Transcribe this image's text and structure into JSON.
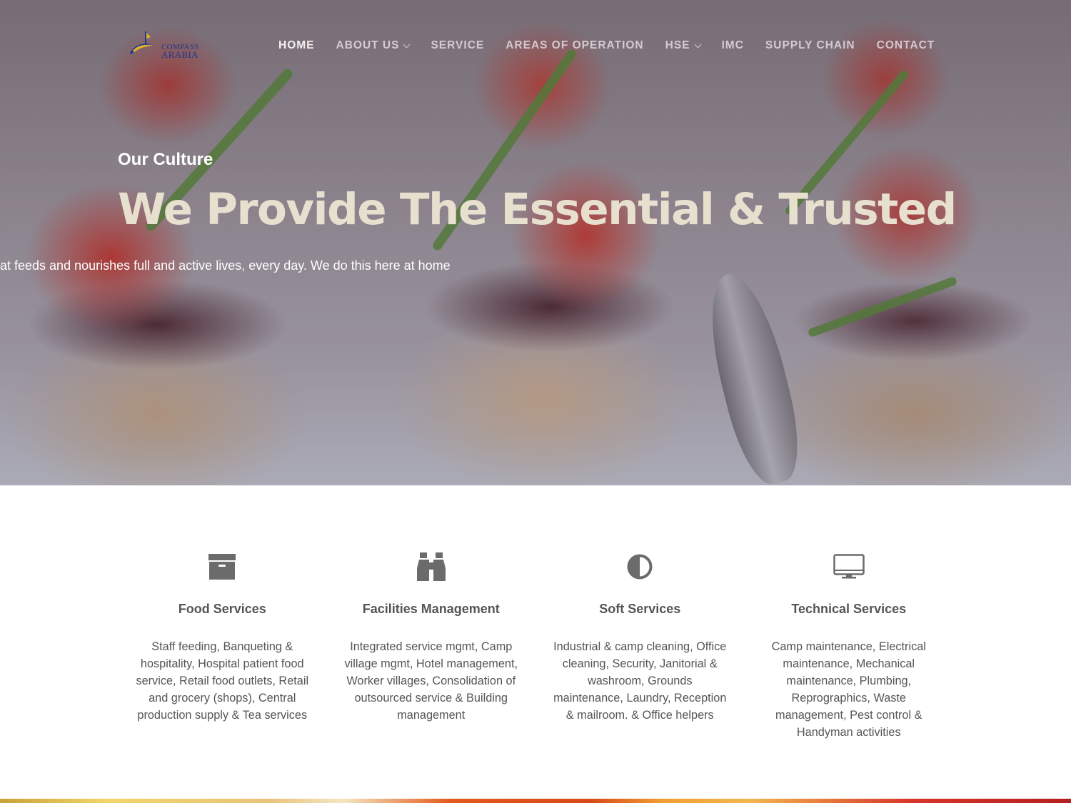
{
  "logo": {
    "line1": "COMPASS",
    "line2": "ARABIA"
  },
  "nav": {
    "items": [
      {
        "label": "HOME"
      },
      {
        "label": "ABOUT US"
      },
      {
        "label": "SERVICE"
      },
      {
        "label": "AREAS OF OPERATION"
      },
      {
        "label": "HSE"
      },
      {
        "label": "IMC"
      },
      {
        "label": "SUPPLY CHAIN"
      },
      {
        "label": "CONTACT"
      }
    ]
  },
  "hero": {
    "subtitle": "Our Culture",
    "headline": "We Provide The Essential & Trusted",
    "tagline": "at feeds and nourishes full and active lives, every day. We do this here at home"
  },
  "services": [
    {
      "icon": "archive-box-icon",
      "title": "Food Services",
      "text": "Staff feeding, Banqueting & hospitality, Hospital patient food service, Retail food outlets, Retail and grocery (shops), Central production supply & Tea services"
    },
    {
      "icon": "binoculars-icon",
      "title": "Facilities Management",
      "text": "Integrated service mgmt, Camp village mgmt, Hotel management, Worker villages, Consolidation of outsourced service & Building management"
    },
    {
      "icon": "half-circle-icon",
      "title": "Soft Services",
      "text": "Industrial & camp cleaning, Office cleaning, Security, Janitorial & washroom, Grounds maintenance, Laundry, Reception & mailroom. & Office helpers"
    },
    {
      "icon": "monitor-icon",
      "title": "Technical Services",
      "text": "Camp maintenance, Electrical maintenance, Mechanical maintenance, Plumbing, Reprographics, Waste management, Pest control & Handyman activities"
    }
  ],
  "colors": {
    "icon": "#6b6b6b",
    "text": "#555555",
    "headline": "#e8e0cf",
    "logo": "#1d3b8c"
  }
}
